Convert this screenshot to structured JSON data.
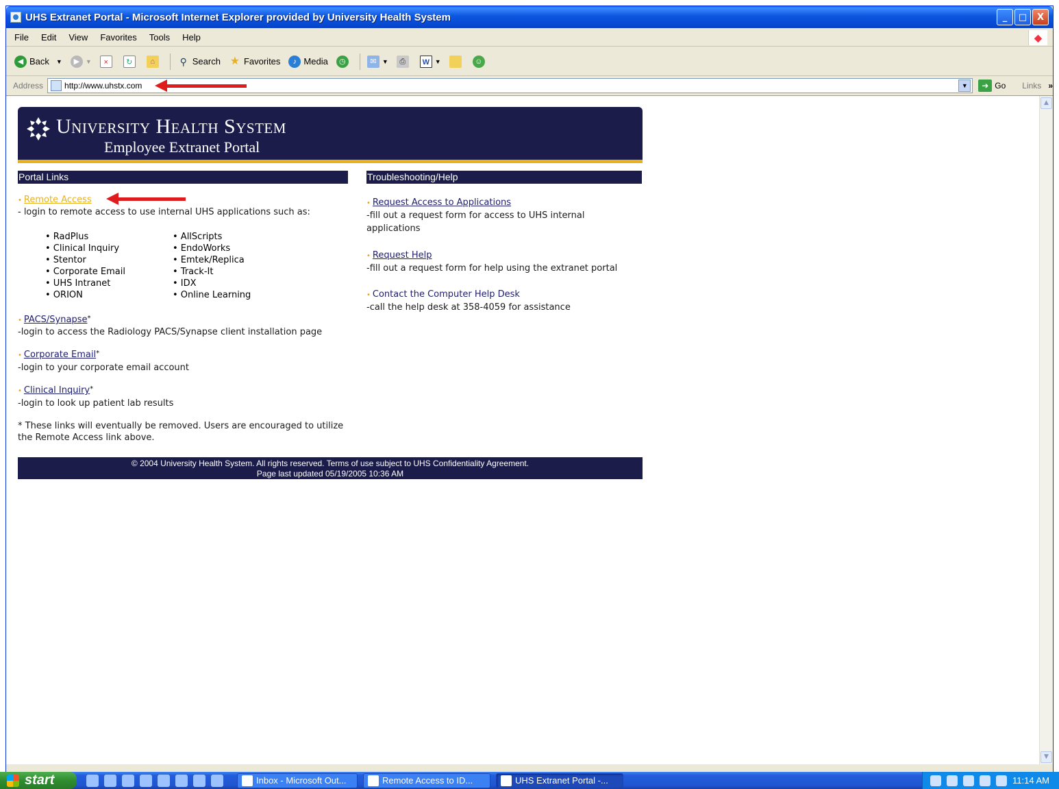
{
  "window": {
    "title": "UHS Extranet Portal - Microsoft Internet Explorer provided by University Health System",
    "minimize": "_",
    "maximize": "□",
    "close": "X"
  },
  "menu": [
    "File",
    "Edit",
    "View",
    "Favorites",
    "Tools",
    "Help"
  ],
  "toolbar": {
    "back": "Back",
    "search": "Search",
    "favorites": "Favorites",
    "media": "Media"
  },
  "address": {
    "label": "Address",
    "url": "http://www.uhstx.com",
    "go": "Go",
    "links": "Links",
    "links_more": "»"
  },
  "banner": {
    "brand": "University Health System",
    "subtitle": "Employee Extranet Portal"
  },
  "portal_links": {
    "heading": "Portal Links",
    "remote_access": "Remote Access",
    "remote_access_desc": "- login to remote access to use internal UHS applications such as:",
    "apps_col1": [
      "• RadPlus",
      "• Clinical Inquiry",
      "• Stentor",
      "• Corporate Email",
      "• UHS Intranet",
      "• ORION"
    ],
    "apps_col2": [
      "• AllScripts",
      "• EndoWorks",
      "• Emtek/Replica",
      "• Track-It",
      "• IDX",
      "• Online Learning"
    ],
    "pacs": "PACS/Synapse",
    "pacs_desc": "-login to access the Radiology PACS/Synapse client installation page",
    "email": "Corporate Email",
    "email_desc": "-login to your corporate email account",
    "clinical": "Clinical Inquiry",
    "clinical_desc": "-login to look up patient lab results",
    "star": "*",
    "note_line1": "* These links will eventually be removed. Users are encouraged to utilize",
    "note_line2": "the Remote Access link above."
  },
  "help": {
    "heading": "Troubleshooting/Help",
    "request_access": "Request Access to Applications",
    "request_access_desc1": "-fill out a request form for access to UHS internal",
    "request_access_desc2": "applications",
    "request_help": "Request Help",
    "request_help_desc": "-fill out a request form for help using the extranet portal",
    "contact": "Contact the Computer Help Desk",
    "contact_desc": "-call the help desk at 358-4059 for assistance"
  },
  "footer": {
    "line1": "© 2004 University Health System. All rights reserved. Terms of use subject to UHS Confidentiality Agreement.",
    "line2": "Page last updated 05/19/2005 10:36 AM"
  },
  "taskbar": {
    "start": "start",
    "tasks": [
      "Inbox - Microsoft Out...",
      "Remote Access to ID...",
      "UHS Extranet Portal -..."
    ],
    "clock": "11:14 AM"
  },
  "colors": {
    "navy": "#1c1c4a",
    "gold": "#e8b21e",
    "annotation_arrow": "#e01b1b"
  }
}
